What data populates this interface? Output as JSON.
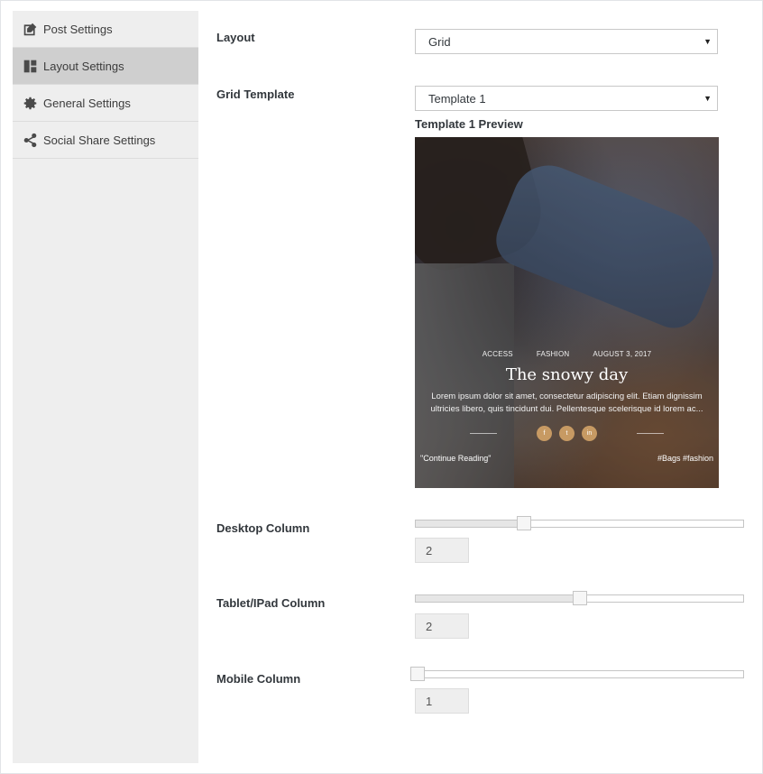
{
  "sidebar": {
    "items": [
      {
        "label": "Post Settings",
        "icon": "edit-icon"
      },
      {
        "label": "Layout Settings",
        "icon": "layout-icon",
        "active": true
      },
      {
        "label": "General Settings",
        "icon": "gear-icon"
      },
      {
        "label": "Social Share Settings",
        "icon": "share-icon"
      }
    ]
  },
  "layout": {
    "label": "Layout",
    "value": "Grid"
  },
  "grid_template": {
    "label": "Grid Template",
    "value": "Template 1",
    "preview_label": "Template 1 Preview"
  },
  "preview": {
    "meta": [
      "ACCESS",
      "FASHION",
      "AUGUST 3, 2017"
    ],
    "title": "The snowy day",
    "excerpt": "Lorem ipsum dolor sit amet, consectetur adipiscing elit. Etiam dignissim ultricies libero, quis tincidunt dui. Pellentesque scelerisque id lorem ac...",
    "social": [
      "f",
      "t",
      "in"
    ],
    "continue": "\"Continue Reading\"",
    "tags": "#Bags  #fashion"
  },
  "columns": {
    "desktop": {
      "label": "Desktop Column",
      "value": "2",
      "fraction": 0.33
    },
    "tablet": {
      "label": "Tablet/IPad Column",
      "value": "2",
      "fraction": 0.5
    },
    "mobile": {
      "label": "Mobile Column",
      "value": "1",
      "fraction": 0.0
    }
  },
  "colors": {
    "sidebar_bg": "#eeeeee",
    "sidebar_active": "#cfcfcf",
    "social_accent": "#c79a63"
  }
}
